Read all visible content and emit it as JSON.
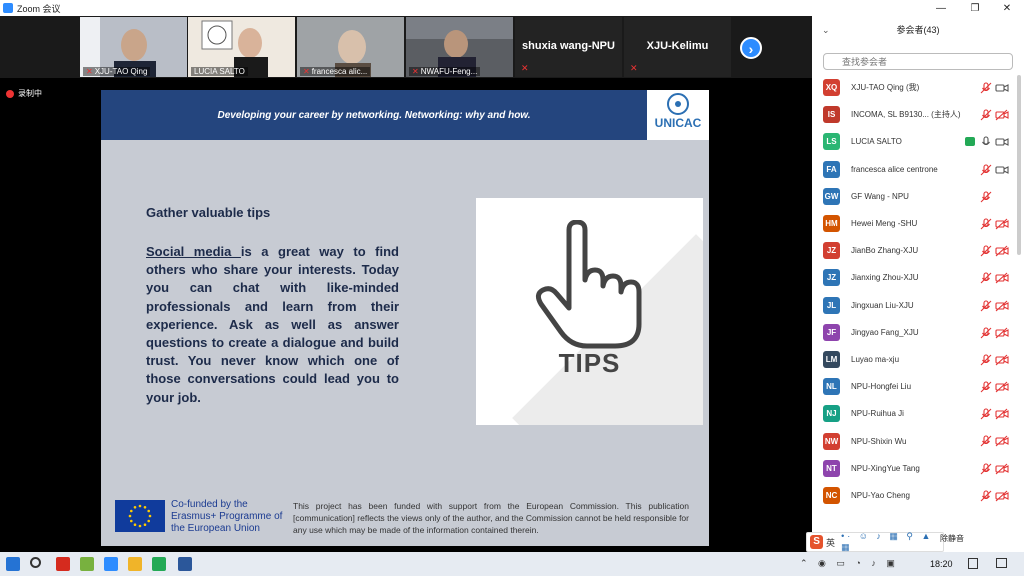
{
  "window": {
    "title": "Zoom 会议"
  },
  "colors": {
    "accent": "#2d8cff",
    "slide_header": "#24457e",
    "muted": "#e33333"
  },
  "video_strip": {
    "tiles": [
      {
        "name": "XJU-TAO Qing",
        "muted": true
      },
      {
        "name": "LUCIA SALTO",
        "muted": false
      },
      {
        "name": "francesca alic...",
        "muted": true
      },
      {
        "name": "NWAFU-Feng...",
        "muted": true
      }
    ],
    "name_tiles": [
      {
        "name": "shuxia wang-NPU",
        "muted": true
      },
      {
        "name": "XJU-Kelimu",
        "muted": true
      }
    ],
    "next_icon": "chevron-right-icon"
  },
  "recording": {
    "label": "录制中"
  },
  "slide": {
    "header_text": "Developing your career by networking. Networking: why and how.",
    "logo_text": "UNICAC",
    "tips_title": "Gather valuable tips",
    "tips_link": "Social media ",
    "tips_body": "is a great way to find others who share your interests. Today you can chat with like-minded professionals and learn from their experience. Ask as well as answer questions to create a dialogue and build trust. You never know which one of those conversations could lead you to your job.",
    "tips_label": "TIPS",
    "eu_text": "Co-funded by the Erasmus+ Programme of the European Union",
    "disclaimer": "This project has been funded with support from the European Commission. This publication [communication] reflects the views only of the author, and the Commission cannot be held responsible for any use which may be made of the information contained therein."
  },
  "panel": {
    "title": "参会者(43)",
    "search_placeholder": "查找参会者",
    "participants": [
      {
        "initials": "XQ",
        "name": "XJU-TAO Qing (我)",
        "color": "#d23f31",
        "mic": "muted",
        "cam": "on"
      },
      {
        "initials": "IS",
        "name": "INCOMA, SL B9130... (主持人)",
        "color": "#c0392b",
        "mic": "muted",
        "cam": "off"
      },
      {
        "initials": "LS",
        "name": "LUCIA SALTO",
        "color": "#2bb673",
        "mic": "on",
        "cam": "on",
        "sharing": true
      },
      {
        "initials": "FA",
        "name": "francesca alice centrone",
        "color": "#2e75b6",
        "mic": "muted",
        "cam": "on"
      },
      {
        "initials": "GW",
        "name": "GF Wang - NPU",
        "color": "#2e75b6",
        "mic": "muted",
        "cam": "none"
      },
      {
        "initials": "HM",
        "name": "Hewei Meng -SHU",
        "color": "#d35400",
        "mic": "muted",
        "cam": "off"
      },
      {
        "initials": "JZ",
        "name": "JianBo Zhang-XJU",
        "color": "#d23f31",
        "mic": "muted",
        "cam": "off"
      },
      {
        "initials": "JZ",
        "name": "Jianxing Zhou-XJU",
        "color": "#2e75b6",
        "mic": "muted",
        "cam": "off"
      },
      {
        "initials": "JL",
        "name": "Jingxuan Liu-XJU",
        "color": "#2e75b6",
        "mic": "muted",
        "cam": "off"
      },
      {
        "initials": "JF",
        "name": "Jingyao Fang_XJU",
        "color": "#8e44ad",
        "mic": "muted",
        "cam": "off"
      },
      {
        "initials": "LM",
        "name": "Luyao ma-xju",
        "color": "#34495e",
        "mic": "muted",
        "cam": "off"
      },
      {
        "initials": "NL",
        "name": "NPU-Hongfei Liu",
        "color": "#2e75b6",
        "mic": "muted",
        "cam": "off"
      },
      {
        "initials": "NJ",
        "name": "NPU-Ruihua Ji",
        "color": "#16a085",
        "mic": "muted",
        "cam": "off"
      },
      {
        "initials": "NW",
        "name": "NPU-Shixin Wu",
        "color": "#d23f31",
        "mic": "muted",
        "cam": "off"
      },
      {
        "initials": "NT",
        "name": "NPU-XingYue Tang",
        "color": "#8e44ad",
        "mic": "muted",
        "cam": "off"
      },
      {
        "initials": "NC",
        "name": "NPU-Yao Cheng",
        "color": "#d35400",
        "mic": "muted",
        "cam": "off"
      }
    ],
    "mute_all_partial": "除静音"
  },
  "ime": {
    "lang": "英"
  },
  "taskbar": {
    "time": "18:20"
  }
}
